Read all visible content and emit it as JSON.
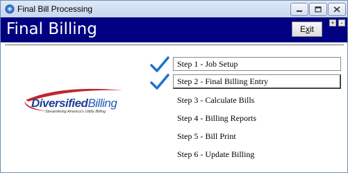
{
  "window": {
    "title": "Final Bill Processing"
  },
  "header": {
    "title": "Final Billing",
    "exit_label": "Exit",
    "exit_accel": "x",
    "plus_label": "+",
    "minus_label": "-"
  },
  "logo": {
    "name_part1": "Diversified",
    "name_part2": "Billing",
    "tagline": "Streamlining America's Utility Billing"
  },
  "steps": [
    {
      "label": "Step 1 - Job Setup",
      "completed": true
    },
    {
      "label": "Step 2 - Final Billing Entry",
      "completed": true
    },
    {
      "label": "Step 3 - Calculate Bills",
      "completed": false
    },
    {
      "label": "Step 4 - Billing Reports",
      "completed": false
    },
    {
      "label": "Step 5 - Bill Print",
      "completed": false
    },
    {
      "label": "Step 6 - Update Billing",
      "completed": false
    }
  ],
  "colors": {
    "header_bg": "#000080",
    "check": "#1e6fd0",
    "logo_red": "#c0262d",
    "logo_blue": "#1f3f95"
  }
}
